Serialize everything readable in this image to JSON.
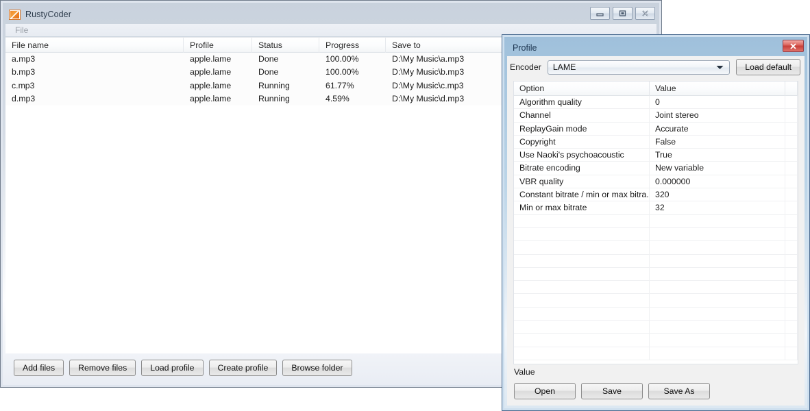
{
  "main_window": {
    "title": "RustyCoder",
    "icon": "app-image-icon",
    "controls": [
      {
        "name": "minimize",
        "glyph": "minimize-icon"
      },
      {
        "name": "maximize",
        "glyph": "maximize-icon"
      },
      {
        "name": "close",
        "glyph": "close-icon"
      }
    ],
    "menu": [
      {
        "label": "File"
      }
    ],
    "file_list": {
      "columns": [
        "File name",
        "Profile",
        "Status",
        "Progress",
        "Save to"
      ],
      "rows": [
        {
          "file_name": "a.mp3",
          "profile": "apple.lame",
          "status": "Done",
          "progress": "100.00%",
          "save_to": "D:\\My Music\\a.mp3"
        },
        {
          "file_name": "b.mp3",
          "profile": "apple.lame",
          "status": "Done",
          "progress": "100.00%",
          "save_to": "D:\\My Music\\b.mp3"
        },
        {
          "file_name": "c.mp3",
          "profile": "apple.lame",
          "status": "Running",
          "progress": "61.77%",
          "save_to": "D:\\My Music\\c.mp3"
        },
        {
          "file_name": "d.mp3",
          "profile": "apple.lame",
          "status": "Running",
          "progress": "4.59%",
          "save_to": "D:\\My Music\\d.mp3"
        }
      ]
    },
    "buttons": [
      {
        "label": "Add files"
      },
      {
        "label": "Remove files"
      },
      {
        "label": "Load profile"
      },
      {
        "label": "Create profile"
      },
      {
        "label": "Browse folder"
      }
    ]
  },
  "profile_dialog": {
    "title": "Profile",
    "close_label": "close-icon",
    "encoder": {
      "label": "Encoder",
      "value": "LAME",
      "load_default_label": "Load default"
    },
    "options_table": {
      "columns": [
        "Option",
        "Value",
        ""
      ],
      "rows": [
        {
          "option": "Algorithm quality",
          "value": "0"
        },
        {
          "option": "Channel",
          "value": "Joint stereo"
        },
        {
          "option": "ReplayGain mode",
          "value": "Accurate"
        },
        {
          "option": "Copyright",
          "value": "False"
        },
        {
          "option": "Use Naoki's psychoacoustic",
          "value": "True"
        },
        {
          "option": "Bitrate encoding",
          "value": "New variable"
        },
        {
          "option": "VBR quality",
          "value": "0.000000"
        },
        {
          "option": "Constant bitrate / min or max bitra...",
          "value": "320"
        },
        {
          "option": "Min or max bitrate",
          "value": "32"
        }
      ],
      "empty_row_count": 11
    },
    "value_label": "Value",
    "buttons": [
      {
        "label": "Open"
      },
      {
        "label": "Save"
      },
      {
        "label": "Save As"
      }
    ]
  },
  "colors": {
    "active_title": "#9fc0db",
    "inactive_title": "#c9d2dd",
    "close_red": "#c8403a",
    "icon_orange": "#f08a2a"
  }
}
